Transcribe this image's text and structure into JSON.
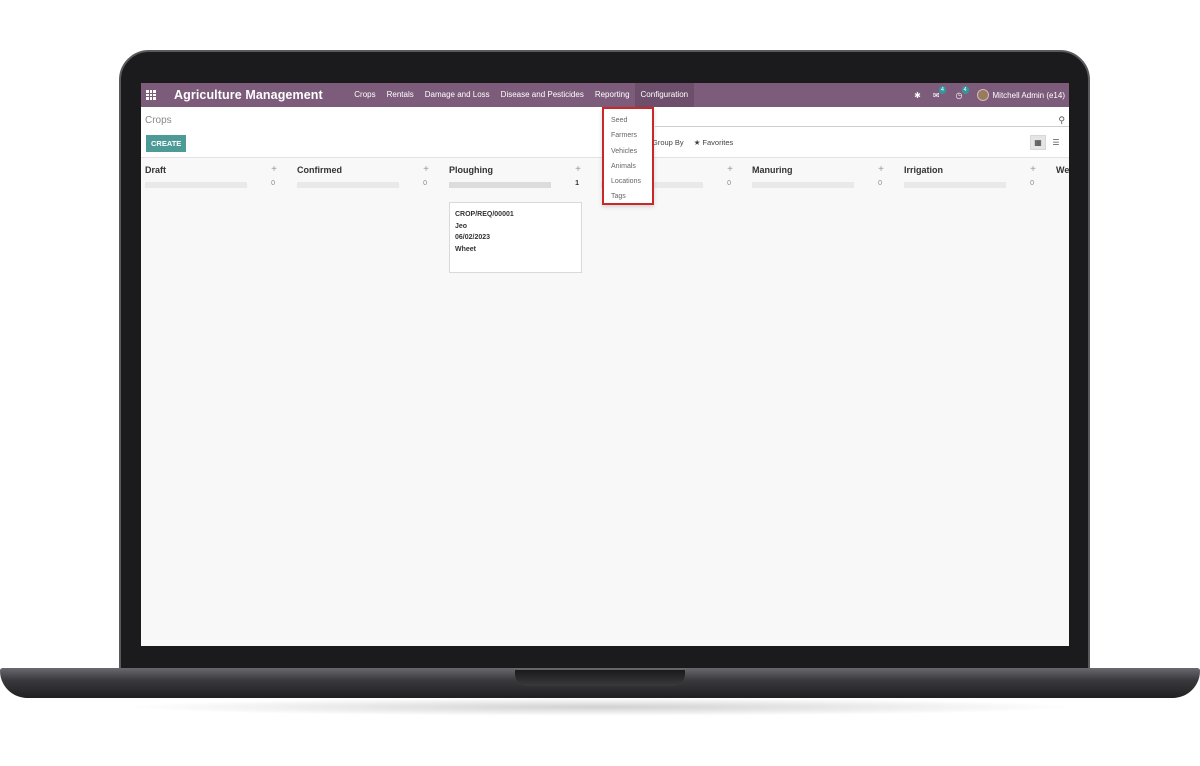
{
  "topbar": {
    "app_title": "Agriculture Management",
    "menu": [
      {
        "label": "Crops"
      },
      {
        "label": "Rentals"
      },
      {
        "label": "Damage and Loss"
      },
      {
        "label": "Disease and Pesticides"
      },
      {
        "label": "Reporting"
      },
      {
        "label": "Configuration"
      }
    ],
    "messages_badge": "4",
    "activities_badge": "4",
    "user_name": "Mitchell Admin (e14)"
  },
  "control": {
    "breadcrumb": "Crops",
    "create_label": "CREATE",
    "group_by_label": "Group By",
    "favorites_label": "Favorites"
  },
  "config_dropdown": {
    "items": [
      {
        "label": "Seed"
      },
      {
        "label": "Farmers"
      },
      {
        "label": "Vehicles"
      },
      {
        "label": "Animals"
      },
      {
        "label": "Locations"
      },
      {
        "label": "Tags"
      }
    ]
  },
  "kanban": {
    "columns": [
      {
        "title": "Draft",
        "count": "0"
      },
      {
        "title": "Confirmed",
        "count": "0"
      },
      {
        "title": "Ploughing",
        "count": "1"
      },
      {
        "title": "",
        "count": "0"
      },
      {
        "title": "Manuring",
        "count": "0"
      },
      {
        "title": "Irrigation",
        "count": "0"
      },
      {
        "title": "We",
        "count": ""
      }
    ],
    "card": {
      "reference": "CROP/REQ/00001",
      "farmer": "Jeo",
      "date": "06/02/2023",
      "crop": "Wheet"
    }
  },
  "colors": {
    "topbar": "#7c5c7a",
    "create_button": "#4e9a97",
    "highlight_border": "#c82828"
  }
}
